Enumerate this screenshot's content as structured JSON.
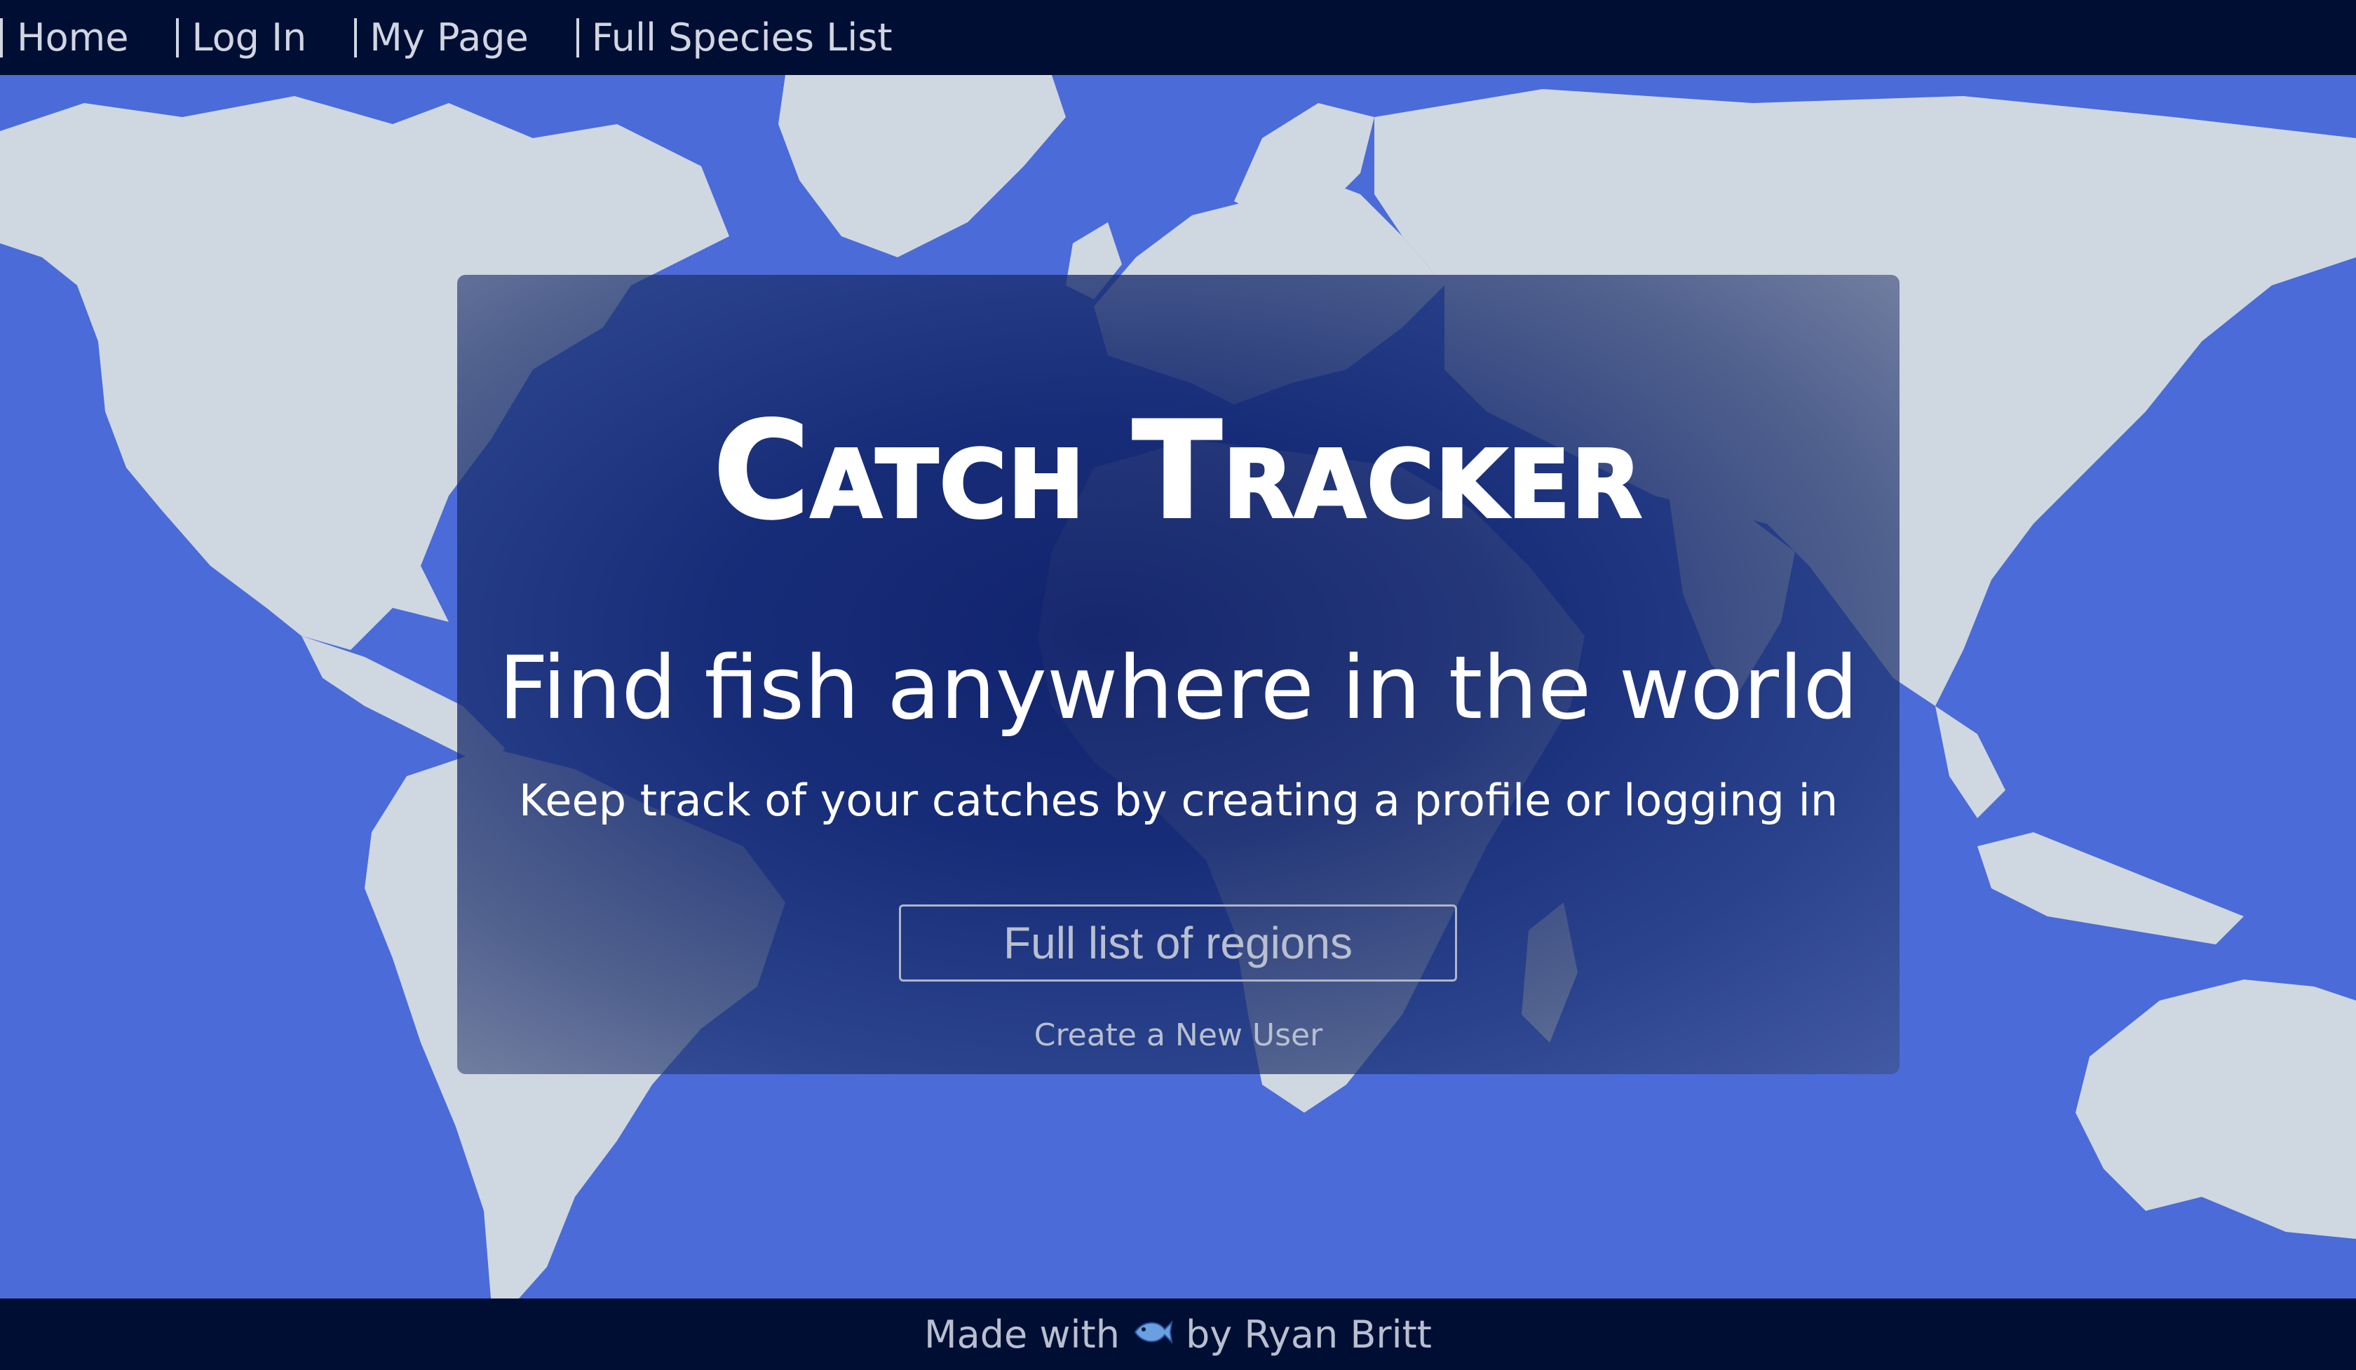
{
  "nav": {
    "items": [
      {
        "label": "Home"
      },
      {
        "label": "Log In"
      },
      {
        "label": "My Page"
      },
      {
        "label": "Full Species List"
      }
    ]
  },
  "hero": {
    "title": "Catch Tracker",
    "headline": "Find fish anywhere in the world",
    "subline": "Keep track of your catches by creating a profile or logging in",
    "regions_button": "Full list of regions",
    "create_user_link": "Create a New User"
  },
  "footer": {
    "prefix": "Made with",
    "icon": "fish-icon",
    "suffix": "by Ryan Britt"
  },
  "colors": {
    "nav_bg": "#000e33",
    "ocean": "#4a6bd8",
    "land": "#cfd7e1",
    "card": "#0f2069"
  }
}
